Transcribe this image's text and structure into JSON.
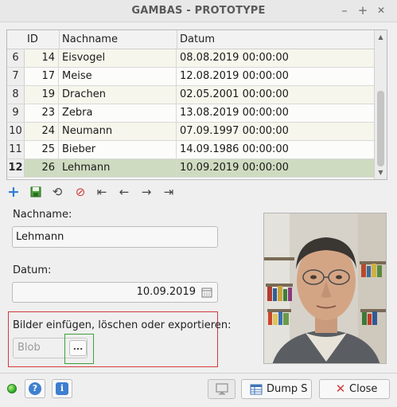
{
  "window": {
    "title": "GAMBAS - PROTOTYPE",
    "min_label": "–",
    "max_label": "+",
    "close_label": "✕"
  },
  "table": {
    "headers": {
      "id": "ID",
      "name": "Nachname",
      "date": "Datum"
    },
    "rows": [
      {
        "num": "6",
        "id": "14",
        "name": "Eisvogel",
        "date": "08.08.2019 00:00:00"
      },
      {
        "num": "7",
        "id": "17",
        "name": "Meise",
        "date": "12.08.2019 00:00:00"
      },
      {
        "num": "8",
        "id": "19",
        "name": "Drachen",
        "date": "02.05.2001 00:00:00"
      },
      {
        "num": "9",
        "id": "23",
        "name": "Zebra",
        "date": "13.08.2019 00:00:00"
      },
      {
        "num": "10",
        "id": "24",
        "name": "Neumann",
        "date": "07.09.1997 00:00:00"
      },
      {
        "num": "11",
        "id": "25",
        "name": "Bieber",
        "date": "14.09.1986 00:00:00"
      },
      {
        "num": "12",
        "id": "26",
        "name": "Lehmann",
        "date": "10.09.2019 00:00:00"
      }
    ],
    "selected_row": "12"
  },
  "toolbar": {
    "icons": [
      "add-icon",
      "save-icon",
      "refresh-icon",
      "cancel-icon",
      "first-icon",
      "previous-icon",
      "next-icon",
      "last-icon"
    ]
  },
  "form": {
    "nachname_label": "Nachname:",
    "nachname_value": "Lehmann",
    "datum_label": "Datum:",
    "datum_value": "10.09.2019",
    "blob_label": "Bilder einfügen, löschen oder exportieren:",
    "blob_placeholder": "Blob",
    "blob_button_label": "..."
  },
  "footer": {
    "dump_label": "Dump S",
    "close_label": "Close"
  },
  "colors": {
    "selected_row": "#cfdbc0",
    "accent_blue": "#3f7fcf",
    "status_led": "#35b12a",
    "frame_red": "#d43a3a",
    "frame_green": "#3aa33a"
  }
}
